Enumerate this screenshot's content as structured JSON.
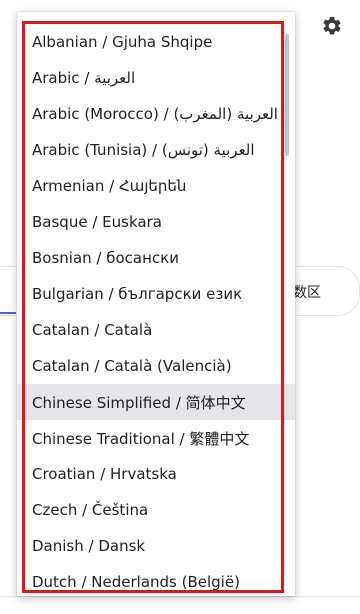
{
  "background": {
    "card_text": "数区"
  },
  "language_dropdown": {
    "selected_index": 10,
    "items": [
      {
        "label": "Albanian / Gjuha Shqipe"
      },
      {
        "label": "Arabic / العربية"
      },
      {
        "label": "Arabic (Morocco) / العربية (المغرب)"
      },
      {
        "label": "Arabic (Tunisia) / العربية (تونس)"
      },
      {
        "label": "Armenian / Հայերեն"
      },
      {
        "label": "Basque / Euskara"
      },
      {
        "label": "Bosnian / босански"
      },
      {
        "label": "Bulgarian / български език"
      },
      {
        "label": "Catalan / Català"
      },
      {
        "label": "Catalan / Català (Valencià)"
      },
      {
        "label": "Chinese Simplified / 简体中文"
      },
      {
        "label": "Chinese Traditional / 繁體中文"
      },
      {
        "label": "Croatian / Hrvatska"
      },
      {
        "label": "Czech / Čeština"
      },
      {
        "label": "Danish / Dansk"
      },
      {
        "label": "Dutch / Nederlands (België)"
      }
    ]
  },
  "icons": {
    "settings": "gear-icon"
  },
  "colors": {
    "highlight_frame": "#e3141c",
    "selected_item_bg": "#e6e6ea",
    "accent": "#5b5fc7"
  }
}
